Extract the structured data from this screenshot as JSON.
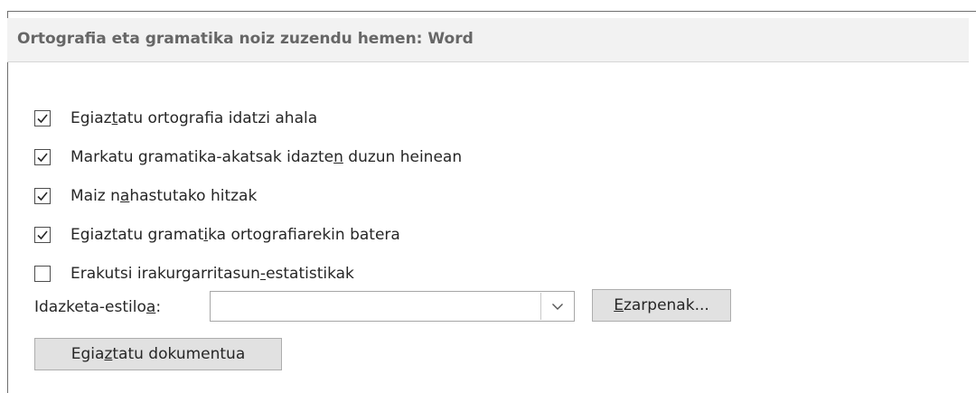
{
  "section": {
    "title": "Ortografia eta gramatika noiz zuzendu hemen: Word"
  },
  "options": [
    {
      "label": "Egiaztatu ortografia idatzi ahala",
      "checked": true
    },
    {
      "label": "Markatu gramatika-akatsak idazten duzun heinean",
      "checked": true
    },
    {
      "label": "Maiz nahastutako hitzak",
      "checked": true
    },
    {
      "label": "Egiaztatu gramatika ortografiarekin batera",
      "checked": true
    },
    {
      "label": "Erakutsi irakurgarritasun-estatistikak",
      "checked": false
    }
  ],
  "writing_style": {
    "label": "Idazketa-estiloa:",
    "value": ""
  },
  "buttons": {
    "settings": "Ezarpenak...",
    "check_document": "Egiaztatu dokumentua"
  },
  "icons": {
    "checkmark": "checkmark-icon",
    "dropdown": "chevron-down-icon"
  },
  "colors": {
    "header_bg": "#f2f2f2",
    "button_bg": "#e1e1e1",
    "text": "#262626"
  }
}
